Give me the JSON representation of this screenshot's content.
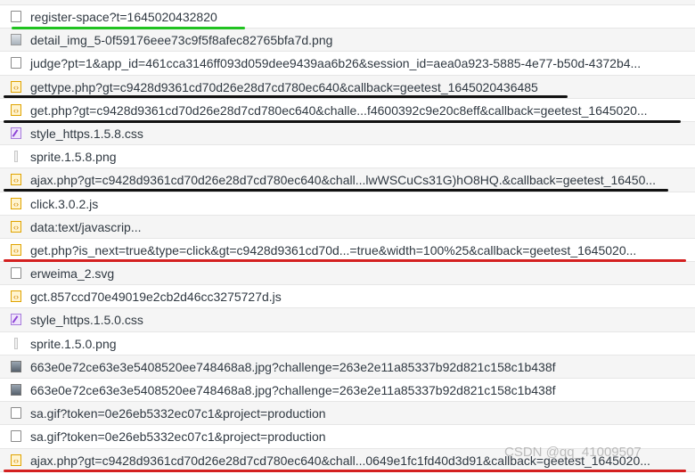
{
  "requests": [
    {
      "name": "register-space?t=1645020432820",
      "icon": "doc-icon"
    },
    {
      "name": "detail_img_5-0f59176eee73c9f5f8afec82765bfa7d.png",
      "icon": "image-icon"
    },
    {
      "name": "judge?pt=1&app_id=461cca3146ff093d059dee9439aa6b26&session_id=aea0a923-5885-4e77-b50d-4372b4...",
      "icon": "doc-icon"
    },
    {
      "name": "gettype.php?gt=c9428d9361cd70d26e28d7cd780ec640&callback=geetest_1645020436485",
      "icon": "script-icon"
    },
    {
      "name": "get.php?gt=c9428d9361cd70d26e28d7cd780ec640&challe...f4600392c9e20c8eff&callback=geetest_1645020...",
      "icon": "script-icon"
    },
    {
      "name": "style_https.1.5.8.css",
      "icon": "stylesheet-icon"
    },
    {
      "name": "sprite.1.5.8.png",
      "icon": "image-thin-icon"
    },
    {
      "name": "ajax.php?gt=c9428d9361cd70d26e28d7cd780ec640&chall...lwWSCuCs31G)hO8HQ.&callback=geetest_16450...",
      "icon": "script-icon"
    },
    {
      "name": "click.3.0.2.js",
      "icon": "script-icon"
    },
    {
      "name": "data:text/javascrip...",
      "icon": "script-icon"
    },
    {
      "name": "get.php?is_next=true&type=click&gt=c9428d9361cd70d...=true&width=100%25&callback=geetest_1645020...",
      "icon": "script-icon"
    },
    {
      "name": "erweima_2.svg",
      "icon": "doc-icon"
    },
    {
      "name": "gct.857ccd70e49019e2cb2d46cc3275727d.js",
      "icon": "script-icon"
    },
    {
      "name": "style_https.1.5.0.css",
      "icon": "stylesheet-icon"
    },
    {
      "name": "sprite.1.5.0.png",
      "icon": "image-thin-icon"
    },
    {
      "name": "663e0e72ce63e3e5408520ee748468a8.jpg?challenge=263e2e11a85337b92d821c158c1b438f",
      "icon": "image-icon"
    },
    {
      "name": "663e0e72ce63e3e5408520ee748468a8.jpg?challenge=263e2e11a85337b92d821c158c1b438f",
      "icon": "image-icon"
    },
    {
      "name": "sa.gif?token=0e26eb5332ec07c1&project=production",
      "icon": "doc-icon"
    },
    {
      "name": "sa.gif?token=0e26eb5332ec07c1&project=production",
      "icon": "doc-icon"
    },
    {
      "name": "ajax.php?gt=c9428d9361cd70d26e28d7cd780ec640&chall...0649e1fc1fd40d3d91&callback=geetest_1645020...",
      "icon": "script-icon"
    }
  ],
  "watermark": "CSDN @qq_41009507",
  "colors": {
    "green_underline": "#21c321",
    "black_underline": "#111111",
    "red_underline": "#d42020"
  }
}
